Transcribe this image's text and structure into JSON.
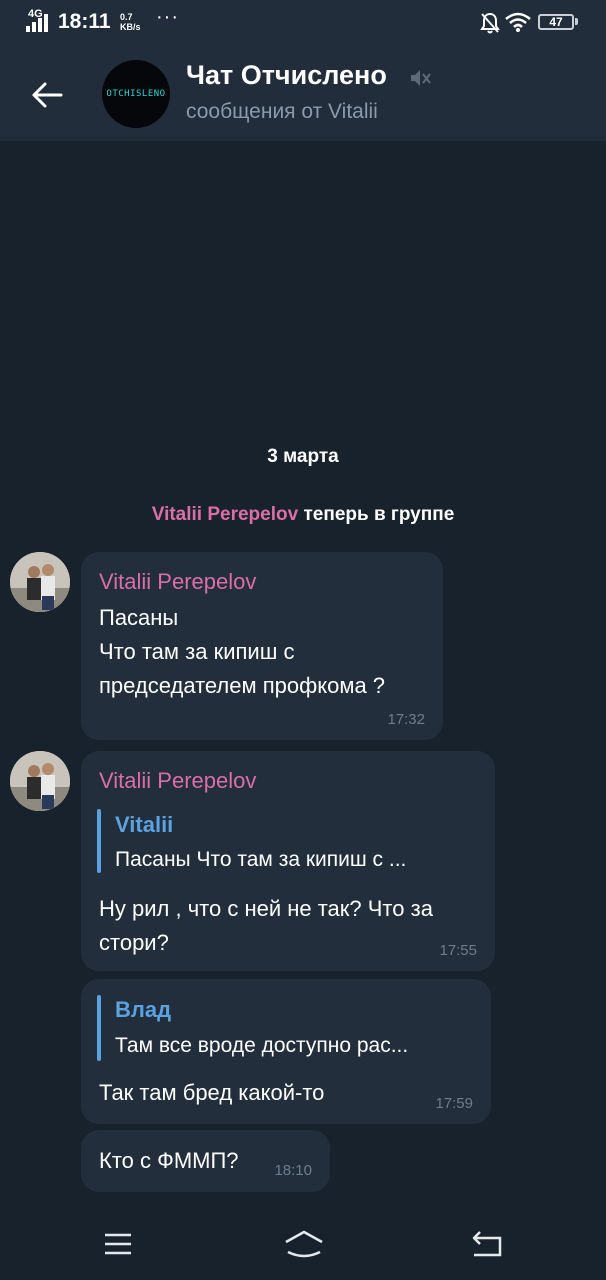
{
  "status_bar": {
    "network": "4G",
    "time": "18:11",
    "speed_value": "0.7",
    "speed_unit": "KB/s",
    "dots": "···",
    "battery": "47",
    "icons": [
      "signal-icon",
      "bell-off-icon",
      "wifi-icon",
      "battery-icon"
    ]
  },
  "header": {
    "title": "Чат Отчислено",
    "subtitle": "сообщения от Vitalii",
    "avatar_text": "OTCHISLENO",
    "icons": [
      "back-arrow-icon",
      "mute-icon"
    ]
  },
  "chat": {
    "date": "3 марта",
    "service": {
      "name": "Vitalii Perepelov",
      "text": " теперь в группе"
    },
    "messages": [
      {
        "sender": "Vitalii Perepelov",
        "lines": [
          "Пасаны",
          "Что там за кипиш с",
          "председателем профкома ?"
        ],
        "time": "17:32"
      },
      {
        "sender": "Vitalii Perepelov",
        "reply": {
          "name": "Vitalii",
          "text": "Пасаны  Что там за кипиш с ..."
        },
        "lines": [
          "Ну рил , что с ней не так? Что за",
          "стори?"
        ],
        "time": "17:55"
      },
      {
        "reply": {
          "name": "Влад",
          "text": "Там все вроде доступно рас..."
        },
        "lines": [
          "Так там бред какой-то"
        ],
        "time": "17:59"
      },
      {
        "lines": [
          "Кто с ФММП?"
        ],
        "time": "18:10"
      }
    ]
  },
  "nav_bar": {
    "icons": [
      "menu-icon",
      "home-icon",
      "back-icon"
    ]
  },
  "colors": {
    "background": "#18222d",
    "header": "#212d3b",
    "bubble": "#222e3b",
    "sender_name": "#d96fa6",
    "reply_accent": "#5aa2e0",
    "time": "#6d7d8c",
    "subtitle": "#8a9aa9"
  }
}
